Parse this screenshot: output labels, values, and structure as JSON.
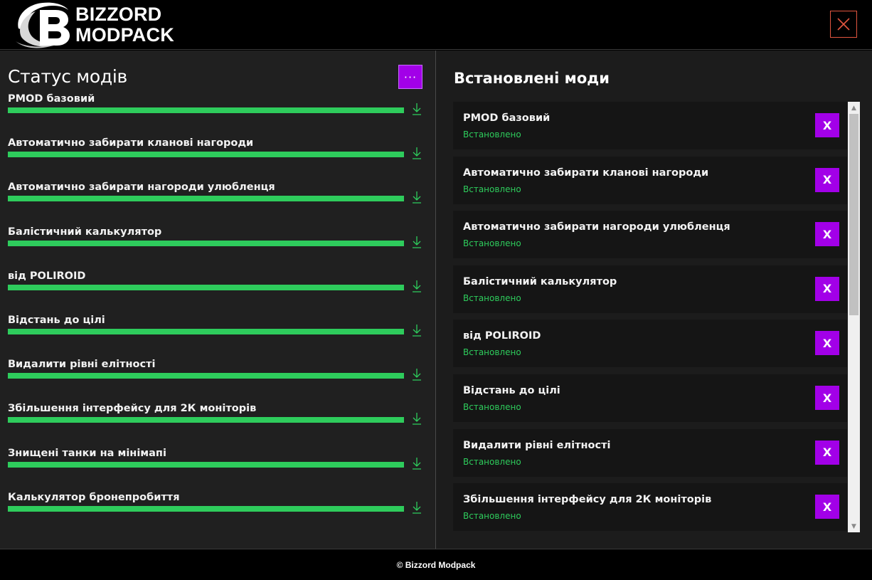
{
  "header": {
    "logo_line1": "BIZZORD",
    "logo_line2": "MODPACK",
    "logo_icon": "bizzord-logo-b",
    "close_icon": "close-icon"
  },
  "left": {
    "title": "Статус модів",
    "more_label": "···",
    "mods": [
      {
        "name": "PMOD базовий",
        "progress": 1.0
      },
      {
        "name": "Автоматично забирати кланові нагороди",
        "progress": 1.0
      },
      {
        "name": "Автоматично забирати нагороди улюбленця",
        "progress": 1.0
      },
      {
        "name": "Балістичний калькулятор",
        "progress": 1.0
      },
      {
        "name": "від POLIROID",
        "progress": 1.0
      },
      {
        "name": "Відстань до цілі",
        "progress": 1.0
      },
      {
        "name": "Видалити рівні елітності",
        "progress": 1.0
      },
      {
        "name": "Збільшення інтерфейсу для 2К моніторів",
        "progress": 1.0
      },
      {
        "name": "Знищені танки на мінімапі",
        "progress": 1.0
      },
      {
        "name": "Калькулятор бронепробиття",
        "progress": 1.0
      }
    ],
    "download_icon": "download-icon"
  },
  "right": {
    "title": "Встановлені моди",
    "remove_label": "X",
    "installed": [
      {
        "name": "PMOD базовий",
        "status": "Встановлено"
      },
      {
        "name": "Автоматично забирати кланові нагороди",
        "status": "Встановлено"
      },
      {
        "name": "Автоматично забирати нагороди улюбленця",
        "status": "Встановлено"
      },
      {
        "name": "Балістичний калькулятор",
        "status": "Встановлено"
      },
      {
        "name": "від POLIROID",
        "status": "Встановлено"
      },
      {
        "name": "Відстань до цілі",
        "status": "Встановлено"
      },
      {
        "name": "Видалити рівні елітності",
        "status": "Встановлено"
      },
      {
        "name": "Збільшення інтерфейсу для 2К моніторів",
        "status": "Встановлено"
      }
    ]
  },
  "footer": {
    "text": "© Bizzord Modpack"
  },
  "colors": {
    "accent_purple": "#a200e8",
    "progress_green": "#2ecc5c",
    "close_red": "#e2553f",
    "panel_left": "#202020",
    "panel_right": "#1c1c1c"
  }
}
